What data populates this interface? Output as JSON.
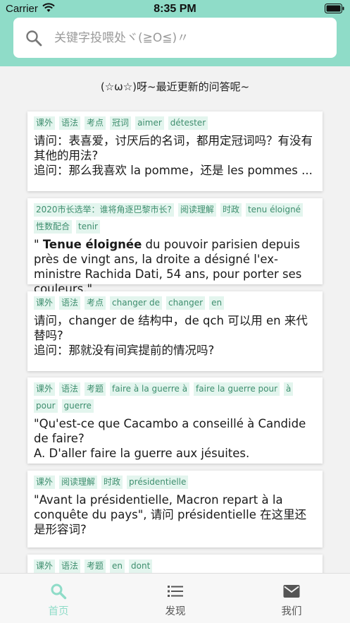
{
  "status_bar": {
    "carrier": "Carrier",
    "time": "8:35 PM"
  },
  "search": {
    "placeholder": "关键字投喂处ヾ(≧O≦)〃"
  },
  "section_title": "(☆ω☆)呀~最近更新的问答呢~",
  "cards": [
    {
      "tags": [
        "课外",
        "语法",
        "考点",
        "冠词",
        "aimer",
        "détester"
      ],
      "line1": "请问：表喜爱，讨厌后的名词，都用定冠词吗？有没有其他的用法?",
      "line2": "追问：那么我喜欢 la pomme，还是 les pommes ..."
    },
    {
      "tags": [
        "2020市长选举：谁将角逐巴黎市长?",
        "阅读理解",
        "时政",
        "tenu éloigné",
        "性数配合",
        "tenir"
      ],
      "quote_open": "\" ",
      "bold": "Tenue éloignée",
      "rest": " du pouvoir parisien depuis près de vingt ans, la droite a désigné l'ex-ministre Rachida Dati, 54 ans, pour porter ses couleurs.\""
    },
    {
      "tags": [
        "课外",
        "语法",
        "考点",
        "changer de",
        "changer",
        "en"
      ],
      "line1": "请问，changer de 结构中，de qch 可以用 en 来代替吗?",
      "line2": "追问：那就没有间宾提前的情况吗?"
    },
    {
      "tags": [
        "课外",
        "语法",
        "考题",
        "faire à la guerre à",
        "faire la guerre pour",
        "à",
        "pour",
        "guerre"
      ],
      "line1": "\"Qu'est-ce que Cacambo a conseillé à Candide de faire?",
      "line2": "A. D'aller faire la guerre aux jésuites."
    },
    {
      "tags": [
        "课外",
        "阅读理解",
        "时政",
        "présidentielle"
      ],
      "line1": "\"Avant la présidentielle, Macron repart à la conquête du pays\", 请问 présidentielle 在这里还是形容词?"
    },
    {
      "tags": [
        "课外",
        "语法",
        "考题",
        "en",
        "dont"
      ]
    }
  ],
  "tabs": [
    {
      "label": "首页",
      "icon": "search-icon",
      "active": true
    },
    {
      "label": "发现",
      "icon": "list-icon",
      "active": false
    },
    {
      "label": "我们",
      "icon": "mail-icon",
      "active": false
    }
  ],
  "colors": {
    "accent": "#8fdcc8",
    "tab_active": "#8fdcc8",
    "tab_inactive": "#555555",
    "tag_bg": "#e3f5ee",
    "tag_text": "#3e8e6e"
  }
}
